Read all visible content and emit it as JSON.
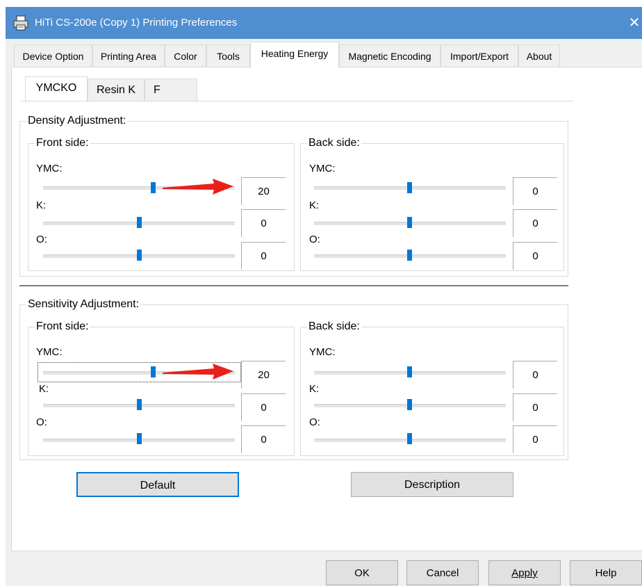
{
  "window": {
    "title": "HiTi CS-200e (Copy 1) Printing Preferences",
    "close_label": "✕"
  },
  "tabs": [
    "Device Option",
    "Printing Area",
    "Color",
    "Tools",
    "Heating Energy",
    "Magnetic Encoding",
    "Import/Export",
    "About"
  ],
  "active_tab": "Heating Energy",
  "subtabs": [
    "YMCKO",
    "Resin K",
    "F"
  ],
  "active_subtab": "YMCKO",
  "density": {
    "title": "Density Adjustment:",
    "front": {
      "title": "Front side:",
      "ymc_label": "YMC:",
      "k_label": "K:",
      "o_label": "O:",
      "ymc_value": "20",
      "k_value": "0",
      "o_value": "0"
    },
    "back": {
      "title": "Back side:",
      "ymc_label": "YMC:",
      "k_label": "K:",
      "o_label": "O:",
      "ymc_value": "0",
      "k_value": "0",
      "o_value": "0"
    }
  },
  "sensitivity": {
    "title": "Sensitivity Adjustment:",
    "front": {
      "title": "Front side:",
      "ymc_label": "YMC:",
      "k_label": "K:",
      "o_label": "O:",
      "ymc_value": "20",
      "k_value": "0",
      "o_value": "0"
    },
    "back": {
      "title": "Back side:",
      "ymc_label": "YMC:",
      "k_label": "K:",
      "o_label": "O:",
      "ymc_value": "0",
      "k_value": "0",
      "o_value": "0"
    }
  },
  "buttons": {
    "default": "Default",
    "description": "Description",
    "ok": "OK",
    "cancel": "Cancel",
    "apply": "Apply",
    "help": "Help"
  },
  "colors": {
    "titlebar": "#4f8ed0",
    "slider_thumb": "#0078d7",
    "annotation_arrow": "#e8201c"
  }
}
